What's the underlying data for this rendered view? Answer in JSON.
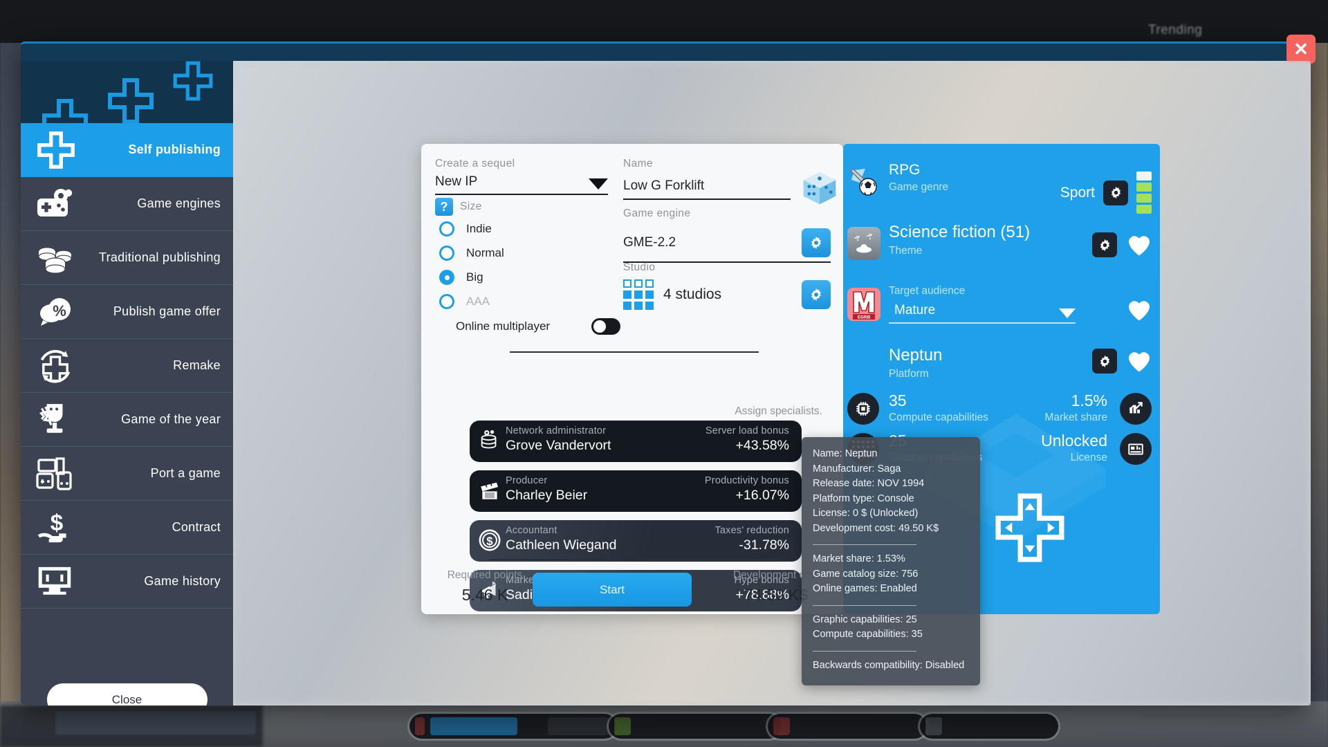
{
  "background": {
    "trending_label": "Trending"
  },
  "window": {
    "close_icon": "close-icon",
    "close_label": "✕"
  },
  "sidebar": {
    "items": [
      {
        "label": "Self publishing",
        "icon": "dpad-icon",
        "active": true
      },
      {
        "label": "Game engines",
        "icon": "gamepad-gear-icon",
        "active": false
      },
      {
        "label": "Traditional publishing",
        "icon": "coins-icon",
        "active": false
      },
      {
        "label": "Publish game offer",
        "icon": "percent-speech-icon",
        "active": false
      },
      {
        "label": "Remake",
        "icon": "dpad-refresh-icon",
        "active": false
      },
      {
        "label": "Game of the year",
        "icon": "trophy-icon",
        "active": false
      },
      {
        "label": "Port a game",
        "icon": "consoles-icon",
        "active": false
      },
      {
        "label": "Contract",
        "icon": "dollar-hand-icon",
        "active": false
      },
      {
        "label": "Game history",
        "icon": "monitor-icon",
        "active": false
      }
    ],
    "close_label": "Close"
  },
  "form": {
    "sequel": {
      "label": "Create a sequel",
      "value": "New IP",
      "caret_icon": "chevron-down-icon"
    },
    "size": {
      "label": "Size",
      "help_icon": "question-mark-icon",
      "options": [
        {
          "label": "Indie",
          "selected": false,
          "disabled": false
        },
        {
          "label": "Normal",
          "selected": false,
          "disabled": false
        },
        {
          "label": "Big",
          "selected": true,
          "disabled": false
        },
        {
          "label": "AAA",
          "selected": false,
          "disabled": true
        }
      ]
    },
    "online_multiplayer": {
      "label": "Online multiplayer",
      "enabled": false
    },
    "name": {
      "label": "Name",
      "value": "Low G Forklift",
      "random_icon": "dice-icon"
    },
    "game_engine": {
      "label": "Game engine",
      "value": "GME-2.2",
      "settings_icon": "gear-icon"
    },
    "studio": {
      "label": "Studio",
      "value": "4 studios",
      "settings_icon": "gear-icon"
    },
    "assign_specialists_label": "Assign specialists.",
    "specialists": [
      {
        "role": "Network administrator",
        "name": "Grove Vandervort",
        "bonus_label": "Server load bonus",
        "bonus_value": "+43.58%",
        "icon": "server-gear-icon"
      },
      {
        "role": "Producer",
        "name": "Charley Beier",
        "bonus_label": "Productivity bonus",
        "bonus_value": "+16.07%",
        "icon": "clapperboard-icon"
      },
      {
        "role": "Accountant",
        "name": "Cathleen Wiegand",
        "bonus_label": "Taxes' reduction",
        "bonus_value": "-31.78%",
        "icon": "dollar-coin-icon"
      },
      {
        "role": "Marketing manager",
        "name": "Sadie Swift",
        "bonus_label": "Hype bonus",
        "bonus_value": "+78.88%",
        "icon": "megaphone-icon"
      }
    ],
    "required_points": {
      "label": "Required points",
      "value": "5.46 K"
    },
    "start_label": "Start",
    "development_cost": {
      "label": "Development cost",
      "value": "74.50 K$"
    }
  },
  "panel": {
    "genre": {
      "value": "RPG",
      "label": "Game genre",
      "secondary": "Sport",
      "icon": "sword-ball-icon",
      "settings_icon": "gear-icon",
      "rating_bars": [
        "#eef7ea",
        "#a5e05a",
        "#a5e05a",
        "#a5e05a"
      ]
    },
    "theme": {
      "value": "Science fiction (51)",
      "label": "Theme",
      "icon": "ufo-icon",
      "settings_icon": "gear-icon",
      "favorite_icon": "heart-icon"
    },
    "target_audience": {
      "label": "Target audience",
      "value": "Mature",
      "rating_icon": "egrb-mature-icon",
      "rating_text": "EGRB",
      "caret_icon": "chevron-down-icon",
      "favorite_icon": "heart-icon"
    },
    "platform": {
      "value": "Neptun",
      "label": "Platform",
      "settings_icon": "gear-icon",
      "favorite_icon": "heart-icon",
      "compute": {
        "value": "35",
        "label": "Compute capabilities",
        "icon": "cpu-icon"
      },
      "graphic": {
        "value": "25",
        "label": "Graphic capabilities",
        "icon": "pixel-grid-icon"
      },
      "market_share": {
        "value": "1.5%",
        "label": "Market share",
        "icon": "chart-up-icon"
      },
      "license": {
        "value": "Unlocked",
        "label": "License",
        "icon": "store-icon"
      }
    },
    "accent_color": "#1fa0e8"
  },
  "tooltip": {
    "group1": [
      "Name: Neptun",
      "Manufacturer: Saga",
      "Release date: NOV 1994",
      "Platform type: Console",
      "License: 0 $ (Unlocked)",
      "Development cost: 49.50 K$"
    ],
    "group2": [
      "Market share: 1.53%",
      "Game catalog size: 756",
      "Online games: Enabled"
    ],
    "group3": [
      "Graphic capabilities: 25",
      "Compute capabilities: 35"
    ],
    "group4": [
      "Backwards compatibility: Disabled"
    ]
  }
}
